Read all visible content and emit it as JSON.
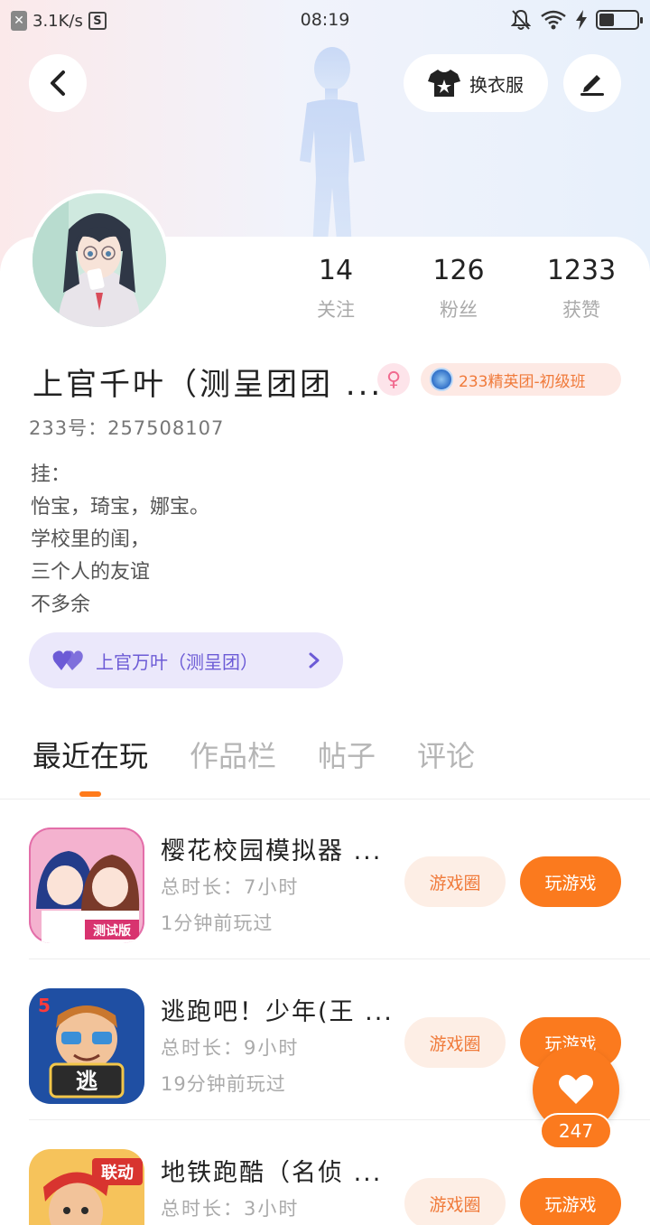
{
  "status_bar": {
    "net_speed": "3.1K/s",
    "time": "08:19"
  },
  "header": {
    "outfit_label": "换衣服"
  },
  "profile": {
    "stats": [
      {
        "value": "14",
        "label": "关注"
      },
      {
        "value": "126",
        "label": "粉丝"
      },
      {
        "value": "1233",
        "label": "获赞"
      }
    ],
    "name": "上官千叶（测呈团团 ...",
    "rank_badge": "233精英团-初级班",
    "uid": "233号：257508107",
    "bio": [
      "挂：",
      "怡宝，琦宝，娜宝。",
      "学校里的闺，",
      "三个人的友谊",
      "不多余"
    ],
    "fan_group": "上官万叶（测呈团）"
  },
  "tabs": [
    {
      "label": "最近在玩"
    },
    {
      "label": "作品栏"
    },
    {
      "label": "帖子"
    },
    {
      "label": "评论"
    }
  ],
  "games": [
    {
      "title": "樱花校园模拟器 ...",
      "duration": "总时长：7小时",
      "last_played": "1分钟前玩过",
      "circle_label": "游戏圈",
      "play_label": "玩游戏",
      "icon": "sakura-school-icon"
    },
    {
      "title": "逃跑吧！少年(王 ...",
      "duration": "总时长：9小时",
      "last_played": "19分钟前玩过",
      "circle_label": "游戏圈",
      "play_label": "玩游戏",
      "icon": "escape-game-icon"
    },
    {
      "title": "地铁跑酷（名侦 ...",
      "duration": "总时长：3小时",
      "last_played": "",
      "circle_label": "游戏圈",
      "play_label": "玩游戏",
      "icon": "subway-surfers-icon"
    }
  ],
  "like_fab": {
    "count": "247"
  },
  "colors": {
    "accent": "#fb7a1e",
    "fan_purple": "#6c5bd6",
    "badge_orange": "#f07a3a"
  }
}
